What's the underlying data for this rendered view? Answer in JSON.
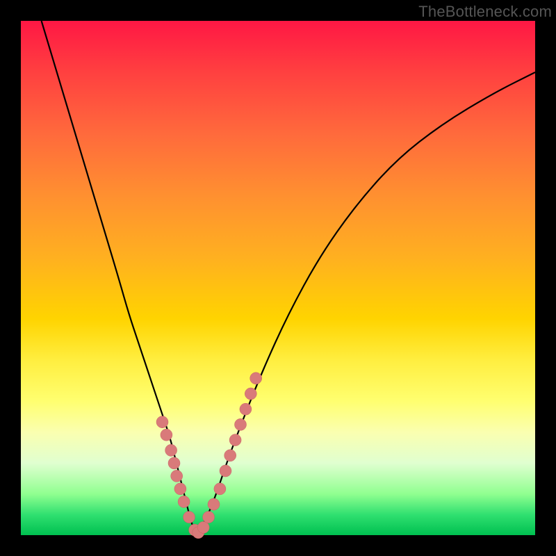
{
  "watermark": "TheBottleneck.com",
  "colors": {
    "background": "#000000",
    "curve": "#000000",
    "dot_fill": "#d97a7a",
    "dot_stroke": "#c86060",
    "gradient_top": "#ff1744",
    "gradient_bottom": "#00c050"
  },
  "chart_data": {
    "type": "line",
    "title": "",
    "xlabel": "",
    "ylabel": "",
    "xlim": [
      0,
      100
    ],
    "ylim": [
      0,
      100
    ],
    "grid": false,
    "legend": false,
    "series": [
      {
        "name": "bottleneck-curve",
        "x": [
          4,
          7,
          10,
          13,
          16,
          19,
          21,
          23,
          25,
          27,
          29,
          30,
          31,
          32,
          33,
          34,
          36,
          38,
          40,
          43,
          47,
          52,
          58,
          65,
          73,
          82,
          92,
          100
        ],
        "values": [
          100,
          90,
          80,
          70,
          60,
          50,
          43,
          37,
          31,
          25,
          19,
          15,
          11,
          7,
          3,
          0,
          3,
          8,
          14,
          22,
          32,
          43,
          54,
          64,
          73,
          80,
          86,
          90
        ]
      }
    ],
    "highlight_points": {
      "name": "dots",
      "x": [
        27.5,
        28.3,
        29.2,
        29.8,
        30.3,
        31.0,
        31.7,
        32.7,
        33.8,
        34.5,
        35.5,
        36.5,
        37.5,
        38.7,
        39.8,
        40.7,
        41.7,
        42.7,
        43.7,
        44.7,
        45.7
      ],
      "values": [
        22,
        19.5,
        16.5,
        14,
        11.5,
        9,
        6.5,
        3.5,
        1.0,
        0.5,
        1.5,
        3.5,
        6.0,
        9.0,
        12.5,
        15.5,
        18.5,
        21.5,
        24.5,
        27.5,
        30.5
      ]
    }
  }
}
